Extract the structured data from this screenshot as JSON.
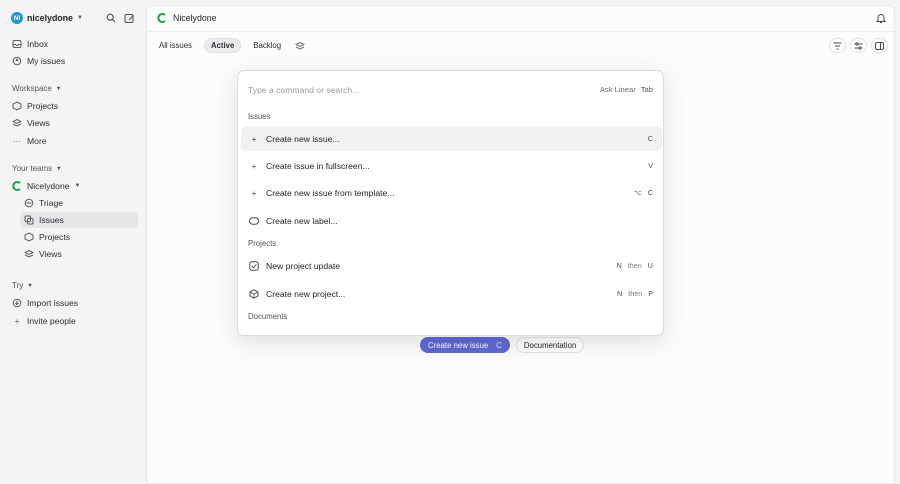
{
  "workspace": {
    "initials": "NI",
    "name": "nicelydone"
  },
  "sidebar": {
    "top_items": [
      {
        "label": "Inbox",
        "icon": "inbox-icon"
      },
      {
        "label": "My issues",
        "icon": "my-issues-icon"
      }
    ],
    "workspace_label": "Workspace",
    "workspace_items": [
      {
        "label": "Projects",
        "icon": "projects-icon"
      },
      {
        "label": "Views",
        "icon": "views-icon"
      },
      {
        "label": "More",
        "icon": "more-icon"
      }
    ],
    "teams_label": "Your teams",
    "team": {
      "name": "Nicelydone"
    },
    "team_items": [
      {
        "label": "Triage",
        "icon": "triage-icon"
      },
      {
        "label": "Issues",
        "icon": "issues-icon",
        "active": true
      },
      {
        "label": "Projects",
        "icon": "projects-icon"
      },
      {
        "label": "Views",
        "icon": "views-icon"
      }
    ],
    "try_label": "Try",
    "try_items": [
      {
        "label": "Import issues",
        "icon": "import-icon"
      },
      {
        "label": "Invite people",
        "icon": "plus-icon"
      }
    ]
  },
  "main": {
    "title": "Nicelydone",
    "tabs": [
      {
        "label": "All issues",
        "active": false
      },
      {
        "label": "Active",
        "active": true
      },
      {
        "label": "Backlog",
        "active": false
      }
    ],
    "empty_actions": {
      "primary_label": "Create new issue",
      "primary_key": "C",
      "secondary_label": "Documentation"
    }
  },
  "palette": {
    "placeholder": "Type a command or search...",
    "ask_label": "Ask Linear",
    "ask_key": "Tab",
    "groups": [
      {
        "label": "Issues",
        "items": [
          {
            "label": "Create new issue...",
            "icon": "plus-icon",
            "keys": [
              "C"
            ],
            "highlighted": true
          },
          {
            "label": "Create issue in fullscreen...",
            "icon": "plus-icon",
            "keys": [
              "V"
            ]
          },
          {
            "label": "Create new issue from template...",
            "icon": "plus-icon",
            "keys": [
              "⌥",
              "C"
            ]
          },
          {
            "label": "Create new label...",
            "icon": "label-icon",
            "keys": []
          }
        ]
      },
      {
        "label": "Projects",
        "items": [
          {
            "label": "New project update",
            "icon": "project-update-icon",
            "keys": [
              "N",
              "then",
              "U"
            ]
          },
          {
            "label": "Create new project...",
            "icon": "project-icon",
            "keys": [
              "N",
              "then",
              "P"
            ]
          }
        ]
      },
      {
        "label": "Documents",
        "items": []
      }
    ]
  },
  "colors": {
    "accent": "#5e6ad2",
    "team_logo": "#16a34a",
    "workspace_avatar": "#1a9ccf"
  }
}
